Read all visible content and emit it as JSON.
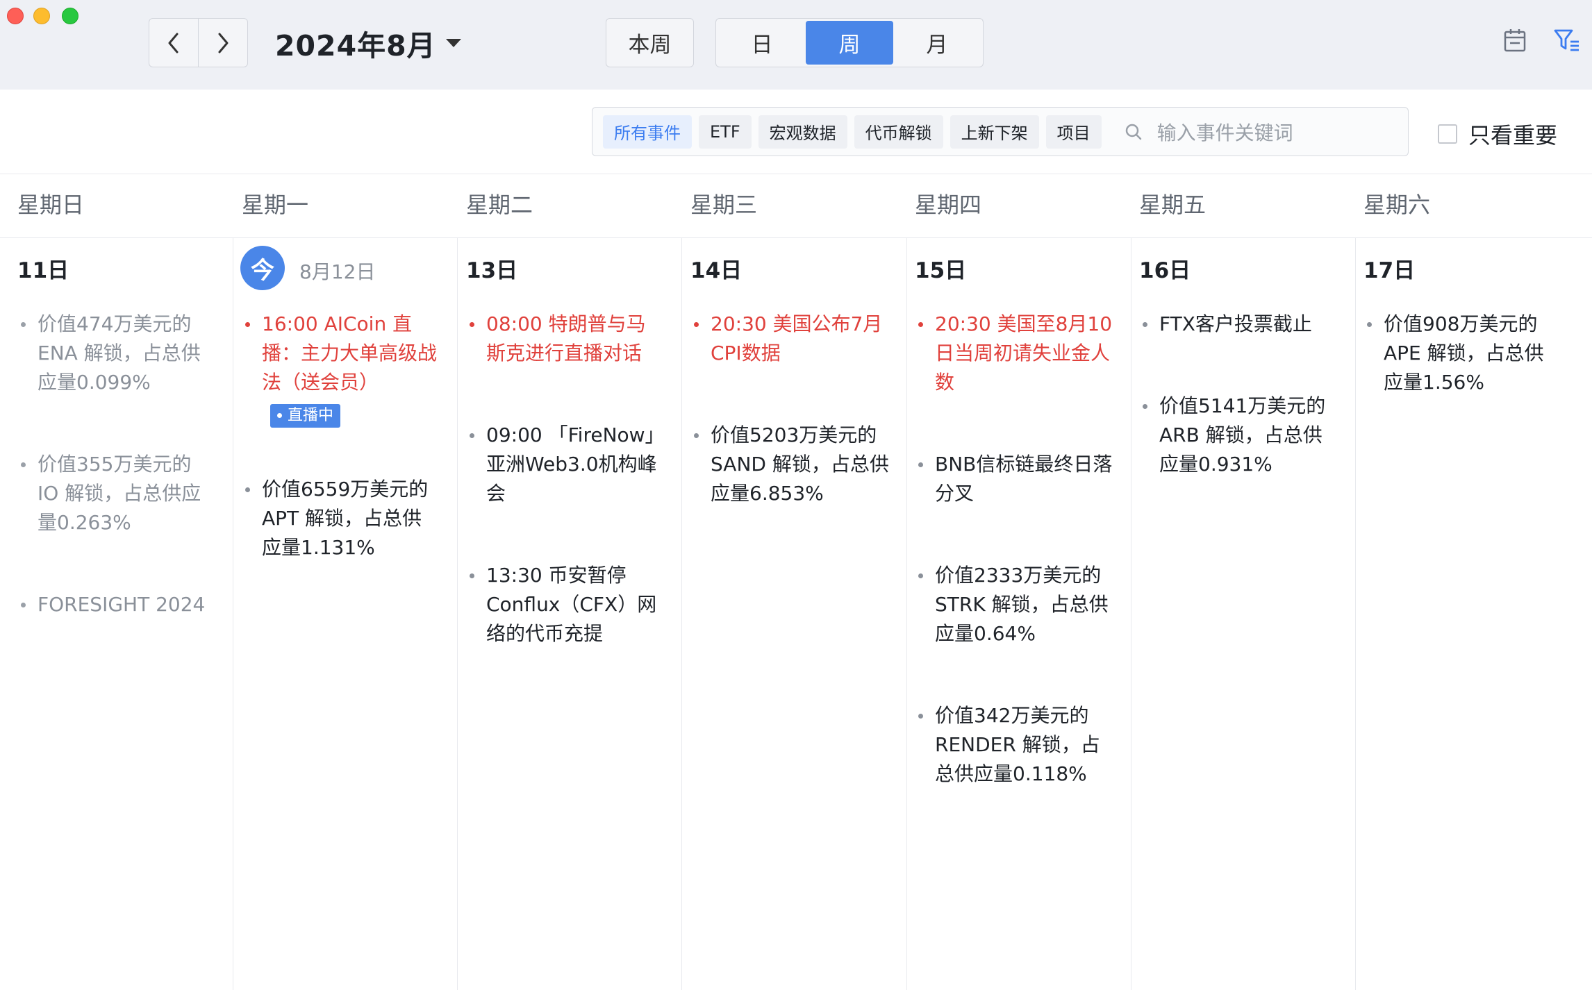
{
  "toolbar": {
    "month_title": "2024年8月",
    "this_week": "本周",
    "views": [
      "日",
      "周",
      "月"
    ],
    "active_view": "周"
  },
  "filters": {
    "chips": [
      "所有事件",
      "ETF",
      "宏观数据",
      "代币解锁",
      "上新下架",
      "项目"
    ],
    "active_chip": "所有事件",
    "search_placeholder": "输入事件关键词",
    "important_only": "只看重要"
  },
  "weekdays": [
    "星期日",
    "星期一",
    "星期二",
    "星期三",
    "星期四",
    "星期五",
    "星期六"
  ],
  "days": [
    {
      "label": "11日",
      "events": [
        {
          "text": "价值474万美元的ENA 解锁，占总供应量0.099%",
          "style": "past"
        },
        {
          "text": "价值355万美元的 IO 解锁，占总供应量0.263%",
          "style": "past"
        },
        {
          "text": "FORESIGHT 2024",
          "style": "past"
        }
      ]
    },
    {
      "label": "8月12日",
      "today_badge": "今",
      "events": [
        {
          "text": "16:00 AICoin 直播：主力大单高级战法（送会员）",
          "style": "red",
          "badge": "直播中"
        },
        {
          "text": "价值6559万美元的APT 解锁，占总供应量1.131%",
          "style": "normal"
        }
      ]
    },
    {
      "label": "13日",
      "events": [
        {
          "text": "08:00 特朗普与马斯克进行直播对话",
          "style": "red"
        },
        {
          "text": "09:00 「FireNow」亚洲Web3.0机构峰会",
          "style": "normal"
        },
        {
          "text": "13:30 币安暂停Conflux（CFX）网络的代币充提",
          "style": "normal"
        }
      ]
    },
    {
      "label": "14日",
      "events": [
        {
          "text": "20:30 美国公布7月CPI数据",
          "style": "red"
        },
        {
          "text": "价值5203万美元的SAND 解锁，占总供应量6.853%",
          "style": "normal"
        }
      ]
    },
    {
      "label": "15日",
      "events": [
        {
          "text": "20:30 美国至8月10日当周初请失业金人数",
          "style": "red"
        },
        {
          "text": "BNB信标链最终日落分叉",
          "style": "normal"
        },
        {
          "text": "价值2333万美元的STRK 解锁，占总供应量0.64%",
          "style": "normal"
        },
        {
          "text": "价值342万美元的RENDER 解锁，占总供应量0.118%",
          "style": "normal"
        }
      ]
    },
    {
      "label": "16日",
      "events": [
        {
          "text": "FTX客户投票截止",
          "style": "normal"
        },
        {
          "text": "价值5141万美元的ARB 解锁，占总供应量0.931%",
          "style": "normal"
        }
      ]
    },
    {
      "label": "17日",
      "events": [
        {
          "text": "价值908万美元的APE 解锁，占总供应量1.56%",
          "style": "normal"
        }
      ]
    }
  ]
}
